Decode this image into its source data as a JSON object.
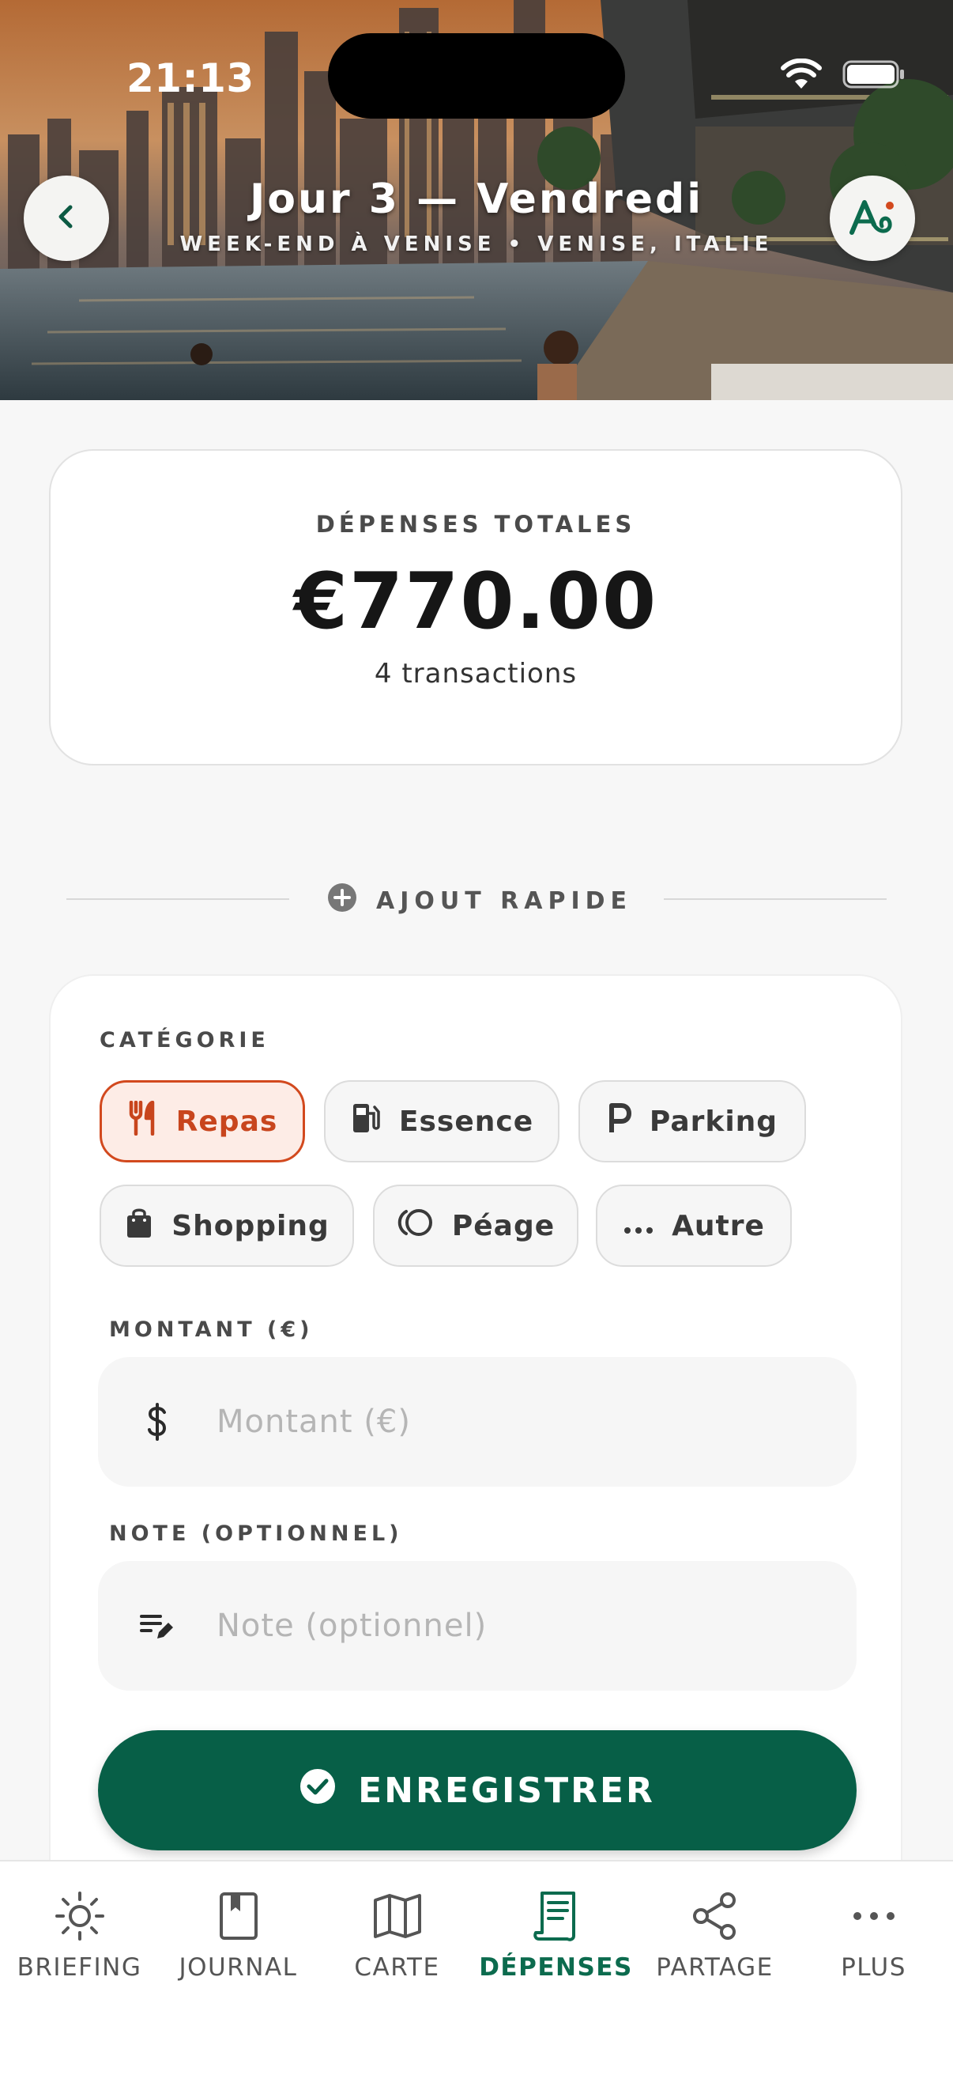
{
  "status_bar": {
    "time": "21:13"
  },
  "header": {
    "title": "Jour 3 — Vendredi",
    "subtitle": "WEEK-END À VENISE • VENISE, ITALIE",
    "back_icon": "chevron-left-icon",
    "avatar_icon": "app-logo-icon"
  },
  "summary": {
    "label": "DÉPENSES TOTALES",
    "total": "€770.00",
    "count": "4 transactions"
  },
  "quick_add": {
    "label": "AJOUT RAPIDE",
    "icon": "plus-circle-icon"
  },
  "form": {
    "category_label": "CATÉGORIE",
    "categories": [
      {
        "label": "Repas",
        "icon": "utensils-icon",
        "selected": true
      },
      {
        "label": "Essence",
        "icon": "fuel-icon",
        "selected": false
      },
      {
        "label": "Parking",
        "icon": "parking-icon",
        "selected": false
      },
      {
        "label": "Shopping",
        "icon": "shopping-bag-icon",
        "selected": false
      },
      {
        "label": "Péage",
        "icon": "toll-icon",
        "selected": false
      },
      {
        "label": "Autre",
        "icon": "more-dots-icon",
        "selected": false
      }
    ],
    "amount_label": "MONTANT (€)",
    "amount_placeholder": "Montant (€)",
    "amount_value": "",
    "note_label": "NOTE (OPTIONNEL)",
    "note_placeholder": "Note (optionnel)",
    "note_value": "",
    "save_label": "ENREGISTRER"
  },
  "nav": {
    "items": [
      {
        "label": "BRIEFING",
        "icon": "sun-icon",
        "active": false
      },
      {
        "label": "JOURNAL",
        "icon": "journal-icon",
        "active": false
      },
      {
        "label": "CARTE",
        "icon": "map-icon",
        "active": false
      },
      {
        "label": "DÉPENSES",
        "icon": "receipt-icon",
        "active": true
      },
      {
        "label": "PARTAGE",
        "icon": "share-icon",
        "active": false
      },
      {
        "label": "PLUS",
        "icon": "more-dots-icon",
        "active": false
      }
    ]
  },
  "colors": {
    "primary": "#075f47",
    "accent": "#d2491e",
    "accent_bg": "#fdece6",
    "nav_active": "#0c6b4e"
  }
}
